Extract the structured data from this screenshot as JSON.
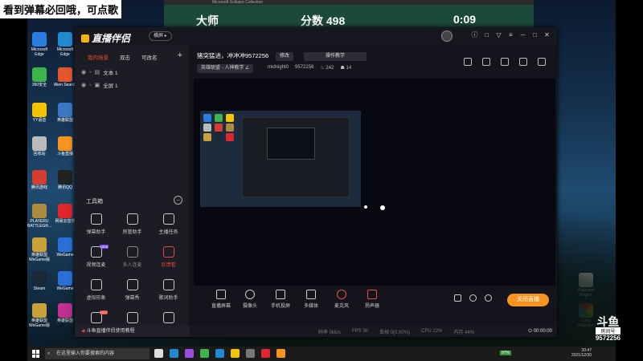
{
  "overlay_caption": "看到弹幕必回哦，可点歌",
  "background_window": {
    "title_bar": "Microsoft Solitaire Collection",
    "left_label": "大师",
    "score_label": "分数 498",
    "timer": "0:09"
  },
  "desktop_icons": {
    "left_col1": [
      "Microsoft Edge",
      "360安全",
      "YY语音",
      "回收站",
      "腾讯游戏",
      "PLAYERU BATTLEGR...",
      "英雄联盟 WeGame版",
      "Steam",
      "英雄联盟 WeGame版"
    ],
    "left_col2": [
      "Microsoft Edge",
      "Alien Search",
      "英雄联盟",
      "斗鱼直播",
      "腾讯QQ",
      "网易云音乐",
      "WeGame",
      "WeGame",
      "英雄联盟"
    ],
    "right": [
      "Wallpaper Engine",
      "Lively Wallpaper"
    ]
  },
  "app": {
    "logo": "直播伴侣",
    "mode_pill": "横屏 ▸",
    "window_controls": [
      "ⓘ",
      "□",
      "▽",
      "≡",
      "─",
      "□",
      "✕"
    ],
    "scene_tabs": [
      "我的场景",
      "双击",
      "可改名"
    ],
    "sources": [
      {
        "label": "文本 1"
      },
      {
        "label": "全屏 1"
      }
    ],
    "toolbox_title": "工具箱",
    "tools": [
      {
        "label": "弹幕助手",
        "state": "normal"
      },
      {
        "label": "房管助手",
        "state": "normal"
      },
      {
        "label": "主播任务",
        "state": "normal"
      },
      {
        "label": "视频连麦",
        "state": "normal",
        "badge": "NEW"
      },
      {
        "label": "多人连麦",
        "state": "dim"
      },
      {
        "label": "反馈看",
        "state": "hot"
      },
      {
        "label": "虚拟形象",
        "state": "normal"
      },
      {
        "label": "弹幕秀",
        "state": "normal"
      },
      {
        "label": "歌词助手",
        "state": "normal"
      },
      {
        "label": "",
        "state": "normal",
        "badge": "HOT"
      },
      {
        "label": "",
        "state": "normal"
      },
      {
        "label": "",
        "state": "normal"
      }
    ],
    "tutorial": "斗鱼直播伴侣使用教程",
    "room_title": "猪突猛进，冲冲冲9572256",
    "edit_label": "修改",
    "ops_label": "操作教学",
    "category": "英雄联盟 - 人神教学 ∠",
    "streamer": "midnight0",
    "room_id": "9572256",
    "hot_count": "242",
    "viewer_count": "14",
    "controls": [
      "直播屏幕",
      "摄像头",
      "手机投屏",
      "多媒体",
      "麦克风",
      "扬声器"
    ],
    "live_button": "关闭直播",
    "status": {
      "bitrate": "码率 0kb/s",
      "fps": "FPS 30",
      "dropped": "丢帧 0(0.00%)",
      "cpu": "CPU 22%",
      "mem": "内存 44%",
      "time": "00:00:00"
    }
  },
  "taskbar": {
    "search_placeholder": "在这里输入你要搜索的内容",
    "battery": "97%",
    "clock": "20:47",
    "date": "2021/12/30"
  },
  "watermark": {
    "logo": "斗鱼",
    "tag": "房间号",
    "room": "9572256"
  },
  "colors": {
    "accent_orange": "#f7941d",
    "hot_red": "#e84c3d",
    "panel_bg": "#1b1c24",
    "preview_bg": "#080910"
  }
}
